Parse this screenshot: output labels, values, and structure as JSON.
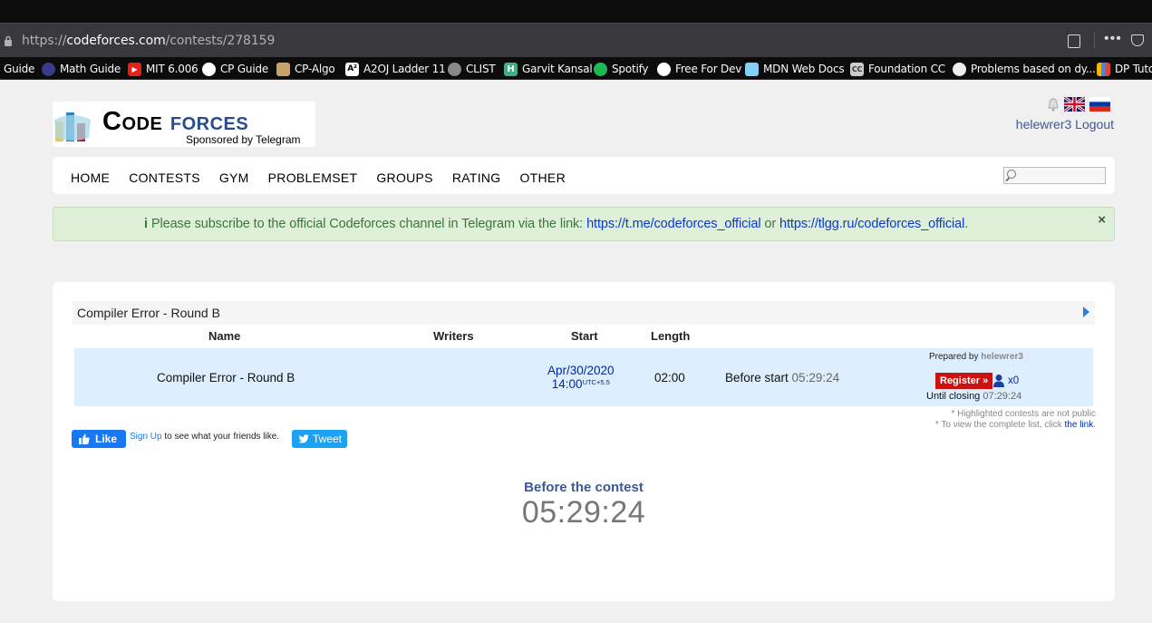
{
  "browser": {
    "url_scheme": "https://",
    "url_host": "codeforces.com",
    "url_path": "/contests/278159",
    "menu_dots": "•••",
    "bookmarks": [
      {
        "label": "Guide",
        "icon": "none"
      },
      {
        "label": "Math Guide",
        "icon": "globe-icon"
      },
      {
        "label": "MIT 6.006",
        "icon": "youtube-icon"
      },
      {
        "label": "CP Guide",
        "icon": "github-icon"
      },
      {
        "label": "CP-Algo",
        "icon": "cp-algo-icon"
      },
      {
        "label": "A2OJ Ladder 11",
        "icon": "a2oj-icon"
      },
      {
        "label": "CLIST",
        "icon": "globe-icon"
      },
      {
        "label": "Garvit Kansal",
        "icon": "h-icon"
      },
      {
        "label": "Spotify",
        "icon": "spotify-icon"
      },
      {
        "label": "Free For Dev",
        "icon": "github-icon"
      },
      {
        "label": "MDN Web Docs",
        "icon": "mdn-icon"
      },
      {
        "label": "Foundation CC",
        "icon": "cc-icon"
      },
      {
        "label": "Problems based on dy...",
        "icon": "chef-icon"
      },
      {
        "label": "DP Tuto",
        "icon": "bars-icon"
      }
    ]
  },
  "site": {
    "logo_code": "Code",
    "logo_forces": "forces",
    "sponsor": "Sponsored by Telegram",
    "username": "helewrer3",
    "logout": "Logout",
    "nav": [
      "Home",
      "Contests",
      "Gym",
      "Problemset",
      "Groups",
      "Rating",
      "Other"
    ],
    "alert": {
      "info_icon": "i",
      "text": "Please subscribe to the official Codeforces channel in Telegram via the link:",
      "link1": "https://t.me/codeforces_official",
      "or": "or",
      "link2": "https://tlgg.ru/codeforces_official",
      "end": ".",
      "close": "×"
    }
  },
  "contest": {
    "title": "Compiler Error - Round B",
    "headers": {
      "name": "Name",
      "writers": "Writers",
      "start": "Start",
      "length": "Length"
    },
    "row": {
      "name": "Compiler Error - Round B",
      "start_date": "Apr/30/2020",
      "start_time": "14:00",
      "utc": "UTC+5.5",
      "length": "02:00",
      "before_label": "Before start",
      "before_countdown": "05:29:24",
      "prepared_label": "Prepared by",
      "prepared_by": "helewrer3",
      "register": "Register »",
      "participants": "x0",
      "closing_label": "Until closing",
      "closing_countdown": "07:29:24"
    },
    "notes": {
      "line1": "* Highlighted contests are not public",
      "line2": "* To view the complete list, click",
      "link": "the link",
      "end": "."
    }
  },
  "social": {
    "like": "Like",
    "signup": "Sign Up",
    "fb_text": "to see what your friends like.",
    "tweet": "Tweet"
  },
  "countdown": {
    "label": "Before the contest",
    "value": "05:29:24"
  }
}
